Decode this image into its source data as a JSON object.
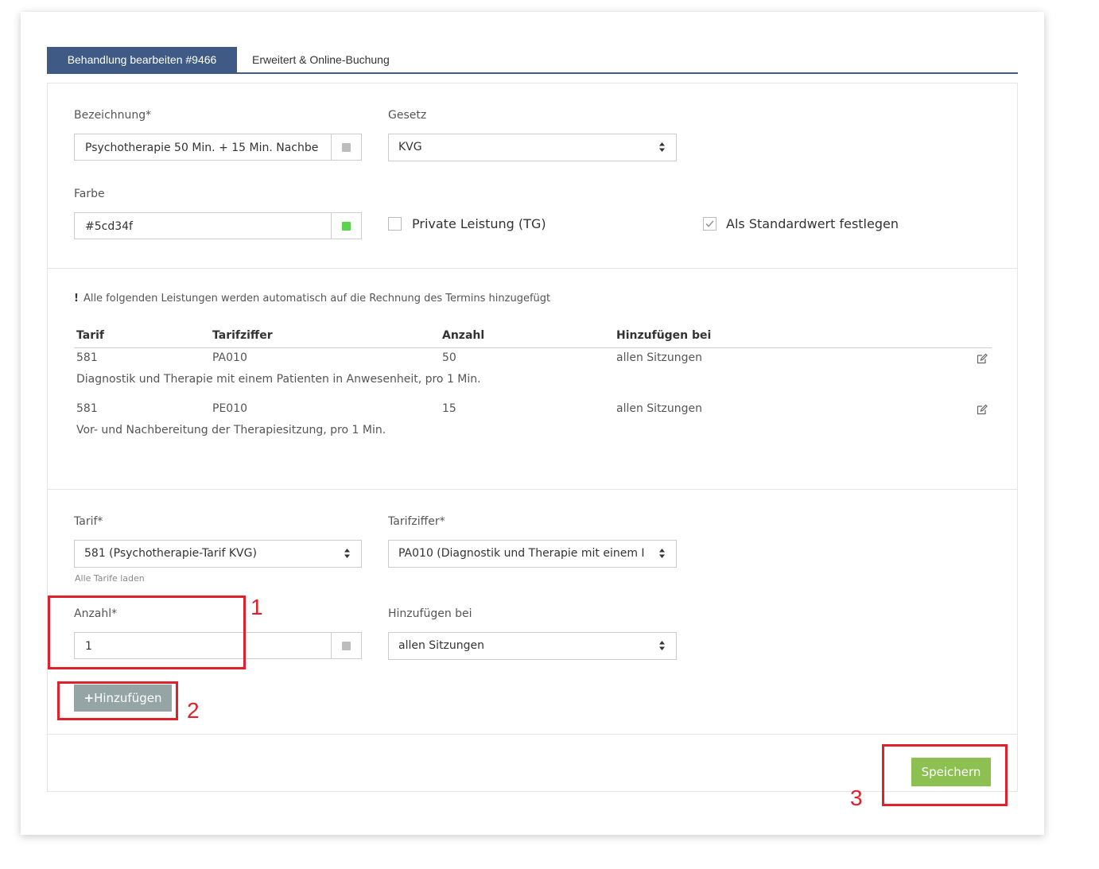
{
  "tabs": [
    {
      "label": "Behandlung bearbeiten #9466",
      "active": true
    },
    {
      "label": "Erweitert & Online-Buchung",
      "active": false
    }
  ],
  "form": {
    "bezeichnung_label": "Bezeichnung*",
    "bezeichnung_value": "Psychotherapie 50 Min. + 15 Min. Nachbe",
    "gesetz_label": "Gesetz",
    "gesetz_value": "KVG",
    "farbe_label": "Farbe",
    "farbe_value": "#5cd34f",
    "private_label": "Private Leistung (TG)",
    "private_checked": false,
    "standard_label": "Als Standardwert festlegen",
    "standard_checked": true
  },
  "services": {
    "note_mark": "!",
    "note": "Alle folgenden Leistungen werden automatisch auf die Rechnung des Termins hinzugefügt",
    "columns": [
      "Tarif",
      "Tarifziffer",
      "Anzahl",
      "Hinzufügen bei"
    ],
    "rows": [
      {
        "tarif": "581",
        "ziffer": "PA010",
        "anzahl": "50",
        "bei": "allen Sitzungen",
        "description": "Diagnostik und Therapie mit einem Patienten in Anwesenheit, pro 1 Min."
      },
      {
        "tarif": "581",
        "ziffer": "PE010",
        "anzahl": "15",
        "bei": "allen Sitzungen",
        "description": "Vor- und Nachbereitung der Therapiesitzung, pro 1 Min."
      }
    ]
  },
  "add_form": {
    "tarif_label": "Tarif*",
    "tarif_value": "581 (Psychotherapie-Tarif KVG)",
    "load_all": "Alle Tarife laden",
    "ziffer_label": "Tarifziffer*",
    "ziffer_value": "PA010 (Diagnostik und Therapie mit einem I",
    "anzahl_label": "Anzahl*",
    "anzahl_value": "1",
    "bei_label": "Hinzufügen bei",
    "bei_value": "allen Sitzungen",
    "add_button": "Hinzufügen",
    "add_icon": "plus-icon"
  },
  "footer": {
    "save_button": "Speichern"
  },
  "annotations": [
    "1",
    "2",
    "3"
  ],
  "colors": {
    "tab_active": "#3e5a85",
    "save": "#8cc152",
    "add": "#95a5a6",
    "swatch": "#5cd34f",
    "annotation": "#e0202a"
  }
}
